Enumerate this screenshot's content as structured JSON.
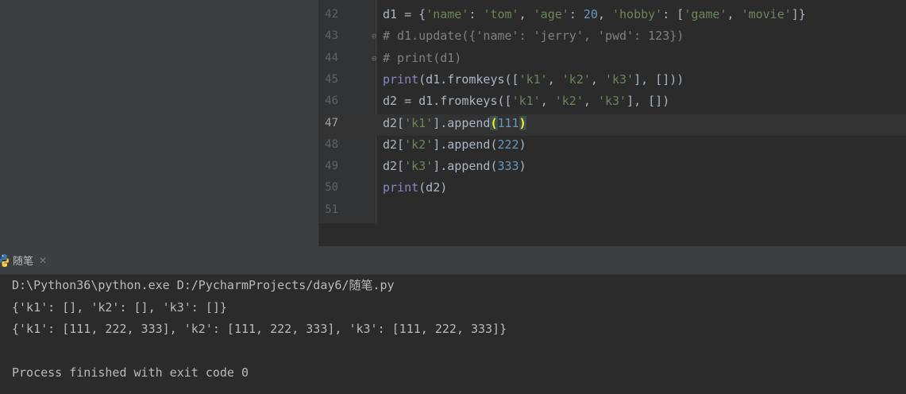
{
  "editor": {
    "active_line": "47",
    "lines": [
      {
        "num": "42",
        "tokens": [
          {
            "t": "d1 = {",
            "c": ""
          },
          {
            "t": "'name'",
            "c": "str"
          },
          {
            "t": ": ",
            "c": ""
          },
          {
            "t": "'tom'",
            "c": "str"
          },
          {
            "t": ", ",
            "c": ""
          },
          {
            "t": "'age'",
            "c": "str"
          },
          {
            "t": ": ",
            "c": ""
          },
          {
            "t": "20",
            "c": "num"
          },
          {
            "t": ", ",
            "c": ""
          },
          {
            "t": "'hobby'",
            "c": "str"
          },
          {
            "t": ": [",
            "c": ""
          },
          {
            "t": "'game'",
            "c": "str"
          },
          {
            "t": ", ",
            "c": ""
          },
          {
            "t": "'movie'",
            "c": "str"
          },
          {
            "t": "]}",
            "c": ""
          }
        ]
      },
      {
        "num": "43",
        "fold": "⊖",
        "tokens": [
          {
            "t": "# d1.update({'name': 'jerry', 'pwd': 123})",
            "c": "comment"
          }
        ]
      },
      {
        "num": "44",
        "fold": "⊖",
        "tokens": [
          {
            "t": "# print(d1)",
            "c": "comment"
          }
        ]
      },
      {
        "num": "45",
        "tokens": [
          {
            "t": "print",
            "c": "builtin"
          },
          {
            "t": "(d1.fromkeys([",
            "c": ""
          },
          {
            "t": "'k1'",
            "c": "str"
          },
          {
            "t": ", ",
            "c": ""
          },
          {
            "t": "'k2'",
            "c": "str"
          },
          {
            "t": ", ",
            "c": ""
          },
          {
            "t": "'k3'",
            "c": "str"
          },
          {
            "t": "], []))",
            "c": ""
          }
        ]
      },
      {
        "num": "46",
        "tokens": [
          {
            "t": "d2 = d1.fromkeys([",
            "c": ""
          },
          {
            "t": "'k1'",
            "c": "str"
          },
          {
            "t": ", ",
            "c": ""
          },
          {
            "t": "'k2'",
            "c": "str"
          },
          {
            "t": ", ",
            "c": ""
          },
          {
            "t": "'k3'",
            "c": "str"
          },
          {
            "t": "], [])",
            "c": ""
          }
        ]
      },
      {
        "num": "47",
        "tokens": [
          {
            "t": "d2[",
            "c": ""
          },
          {
            "t": "'k1'",
            "c": "str"
          },
          {
            "t": "].append",
            "c": ""
          },
          {
            "t": "(",
            "c": "match"
          },
          {
            "t": "111",
            "c": "num"
          },
          {
            "t": ")",
            "c": "match"
          }
        ]
      },
      {
        "num": "48",
        "tokens": [
          {
            "t": "d2[",
            "c": ""
          },
          {
            "t": "'k2'",
            "c": "str"
          },
          {
            "t": "].append(",
            "c": ""
          },
          {
            "t": "222",
            "c": "num"
          },
          {
            "t": ")",
            "c": ""
          }
        ]
      },
      {
        "num": "49",
        "tokens": [
          {
            "t": "d2[",
            "c": ""
          },
          {
            "t": "'k3'",
            "c": "str"
          },
          {
            "t": "].append(",
            "c": ""
          },
          {
            "t": "333",
            "c": "num"
          },
          {
            "t": ")",
            "c": ""
          }
        ]
      },
      {
        "num": "50",
        "tokens": [
          {
            "t": "print",
            "c": "builtin"
          },
          {
            "t": "(d2)",
            "c": ""
          }
        ]
      },
      {
        "num": "51",
        "tokens": []
      }
    ]
  },
  "run_panel": {
    "tab_label": "随笔",
    "tab_icon": "python-icon",
    "close_icon": "close-icon",
    "console_lines": [
      "D:\\Python36\\python.exe D:/PycharmProjects/day6/随笔.py",
      "{'k1': [], 'k2': [], 'k3': []}",
      "{'k1': [111, 222, 333], 'k2': [111, 222, 333], 'k3': [111, 222, 333]}",
      "",
      "Process finished with exit code 0"
    ]
  },
  "colors": {
    "string": "#6a8759",
    "number": "#6897bb",
    "comment": "#808080",
    "builtin": "#8888c6",
    "default": "#a9b7c6",
    "brace_match": "#ffef28"
  }
}
